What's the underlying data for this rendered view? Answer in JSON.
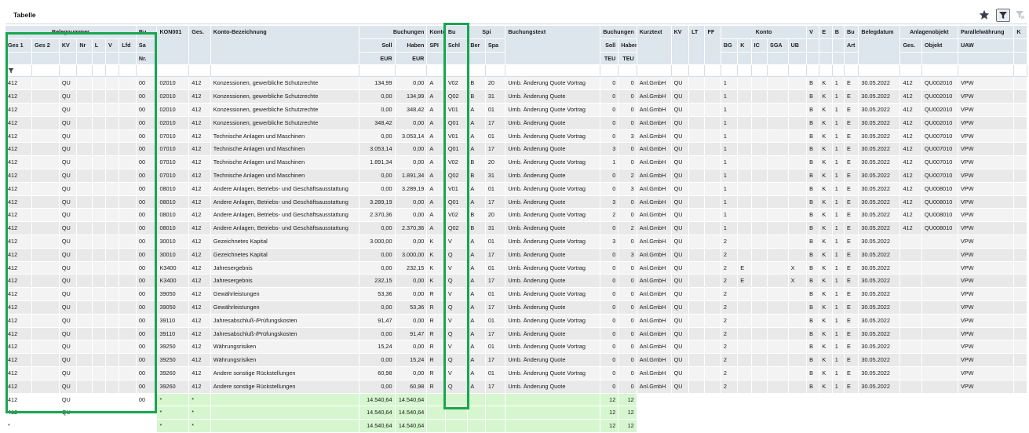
{
  "window": {
    "title": "Tabelle"
  },
  "toolbar": {
    "star_icon": "star-icon",
    "filter_icon": "filter-icon",
    "filter_off_icon": "filter-off-icon"
  },
  "colors": {
    "header_bg": "#dde5ed",
    "row_odd": "#e9e9e9",
    "row_even": "#f3f3f3",
    "sum_bg": "#d6f6cf",
    "highlight": "#18a650"
  },
  "header": {
    "belegnummer": "Belegnummer",
    "bu": "Bu",
    "sa": "Sa",
    "nr": "Nr.",
    "ges1": "Ges 1",
    "ges2": "Ges 2",
    "kv": "KV",
    "nr2": "Nr",
    "l": "L",
    "v": "V",
    "lfd": "Lfd",
    "kon": "KON001",
    "ges": "Ges.",
    "kontobez": "Konto-Bezeichnung",
    "buchungen": "Buchungen",
    "soll": "Soll",
    "haben": "Haben",
    "eur1": "EUR",
    "eur2": "EUR",
    "konto": "Konto",
    "spi": "SPI",
    "buschl_top": "Bu",
    "buschl_bot": "Schl",
    "spi_top": "Spi",
    "ber": "Ber",
    "spa": "Spa",
    "buchungstext": "Buchungstext",
    "buchungen2": "Buchungen",
    "soll2": "Soll",
    "haben2": "Haben",
    "teu1": "TEU",
    "teu2": "TEU",
    "kurztext": "Kurztext",
    "kv2": "KV",
    "lt": "LT",
    "ff": "FF",
    "konto2": "Konto",
    "bg": "BG",
    "k": "K",
    "ic": "IC",
    "sga": "SGA",
    "ub": "UB",
    "v2": "V",
    "e": "E",
    "b": "B",
    "buart_top": "Bu",
    "buart_bot": "Art",
    "belegdatum": "Belegdatum",
    "anlagenobjekt": "Anlagenobjekt",
    "ges3": "Ges.",
    "objekt": "Objekt",
    "parallel": "Parallelwährung",
    "uaw": "UAW",
    "k2": "K"
  },
  "rows": [
    [
      "412",
      "",
      "QU",
      "",
      "",
      "",
      "",
      "00",
      "02010",
      "412",
      "Konzessionen, gewerbliche Schutzrechte",
      "134,99",
      "0,00",
      "A",
      "V02",
      "B",
      "20",
      "Umb. Änderung Quote Vortrag",
      "0",
      "0",
      "Anl.GmbH",
      "QU",
      "",
      "",
      "1",
      "",
      "",
      "",
      "",
      "B",
      "K",
      "1",
      "E",
      "30.05.2022",
      "412",
      "QU002010",
      "VPW",
      ""
    ],
    [
      "412",
      "",
      "QU",
      "",
      "",
      "",
      "",
      "00",
      "02010",
      "412",
      "Konzessionen, gewerbliche Schutzrechte",
      "0,00",
      "134,99",
      "A",
      "Q02",
      "B",
      "31",
      "Umb. Änderung Quote",
      "0",
      "0",
      "Anl.GmbH",
      "QU",
      "",
      "",
      "1",
      "",
      "",
      "",
      "",
      "B",
      "K",
      "1",
      "E",
      "30.05.2022",
      "412",
      "QU002010",
      "VPW",
      ""
    ],
    [
      "412",
      "",
      "QU",
      "",
      "",
      "",
      "",
      "00",
      "02010",
      "412",
      "Konzessionen, gewerbliche Schutzrechte",
      "0,00",
      "348,42",
      "A",
      "V01",
      "A",
      "01",
      "Umb. Änderung Quote Vortrag",
      "0",
      "0",
      "Anl.GmbH",
      "QU",
      "",
      "",
      "1",
      "",
      "",
      "",
      "",
      "B",
      "K",
      "1",
      "E",
      "30.05.2022",
      "412",
      "QU002010",
      "VPW",
      ""
    ],
    [
      "412",
      "",
      "QU",
      "",
      "",
      "",
      "",
      "00",
      "02010",
      "412",
      "Konzessionen, gewerbliche Schutzrechte",
      "348,42",
      "0,00",
      "A",
      "Q01",
      "A",
      "17",
      "Umb. Änderung Quote",
      "0",
      "0",
      "Anl.GmbH",
      "QU",
      "",
      "",
      "1",
      "",
      "",
      "",
      "",
      "B",
      "K",
      "1",
      "E",
      "30.05.2022",
      "412",
      "QU002010",
      "VPW",
      ""
    ],
    [
      "412",
      "",
      "QU",
      "",
      "",
      "",
      "",
      "00",
      "07010",
      "412",
      "Technische Anlagen und Maschinen",
      "0,00",
      "3.053,14",
      "A",
      "V01",
      "A",
      "01",
      "Umb. Änderung Quote Vortrag",
      "0",
      "3",
      "Anl.GmbH",
      "QU",
      "",
      "",
      "1",
      "",
      "",
      "",
      "",
      "B",
      "K",
      "1",
      "E",
      "30.05.2022",
      "412",
      "QU007010",
      "VPW",
      ""
    ],
    [
      "412",
      "",
      "QU",
      "",
      "",
      "",
      "",
      "00",
      "07010",
      "412",
      "Technische Anlagen und Maschinen",
      "3.053,14",
      "0,00",
      "A",
      "Q01",
      "A",
      "17",
      "Umb. Änderung Quote",
      "3",
      "0",
      "Anl.GmbH",
      "QU",
      "",
      "",
      "1",
      "",
      "",
      "",
      "",
      "B",
      "K",
      "1",
      "E",
      "30.05.2022",
      "412",
      "QU007010",
      "VPW",
      ""
    ],
    [
      "412",
      "",
      "QU",
      "",
      "",
      "",
      "",
      "00",
      "07010",
      "412",
      "Technische Anlagen und Maschinen",
      "1.891,34",
      "0,00",
      "A",
      "V02",
      "B",
      "20",
      "Umb. Änderung Quote Vortrag",
      "1",
      "0",
      "Anl.GmbH",
      "QU",
      "",
      "",
      "1",
      "",
      "",
      "",
      "",
      "B",
      "K",
      "1",
      "E",
      "30.05.2022",
      "412",
      "QU007010",
      "VPW",
      ""
    ],
    [
      "412",
      "",
      "QU",
      "",
      "",
      "",
      "",
      "00",
      "07010",
      "412",
      "Technische Anlagen und Maschinen",
      "0,00",
      "1.891,34",
      "A",
      "Q02",
      "B",
      "31",
      "Umb. Änderung Quote",
      "0",
      "2",
      "Anl.GmbH",
      "QU",
      "",
      "",
      "1",
      "",
      "",
      "",
      "",
      "B",
      "K",
      "1",
      "E",
      "30.05.2022",
      "412",
      "QU007010",
      "VPW",
      ""
    ],
    [
      "412",
      "",
      "QU",
      "",
      "",
      "",
      "",
      "00",
      "08010",
      "412",
      "Andere Anlagen, Betriebs- und Geschäftsausstattung",
      "0,00",
      "3.289,19",
      "A",
      "V01",
      "A",
      "01",
      "Umb. Änderung Quote Vortrag",
      "0",
      "3",
      "Anl.GmbH",
      "QU",
      "",
      "",
      "1",
      "",
      "",
      "",
      "",
      "B",
      "K",
      "1",
      "E",
      "30.05.2022",
      "412",
      "QU008010",
      "VPW",
      ""
    ],
    [
      "412",
      "",
      "QU",
      "",
      "",
      "",
      "",
      "00",
      "08010",
      "412",
      "Andere Anlagen, Betriebs- und Geschäftsausstattung",
      "3.289,19",
      "0,00",
      "A",
      "Q01",
      "A",
      "17",
      "Umb. Änderung Quote",
      "3",
      "0",
      "Anl.GmbH",
      "QU",
      "",
      "",
      "1",
      "",
      "",
      "",
      "",
      "B",
      "K",
      "1",
      "E",
      "30.05.2022",
      "412",
      "QU008010",
      "VPW",
      ""
    ],
    [
      "412",
      "",
      "QU",
      "",
      "",
      "",
      "",
      "00",
      "08010",
      "412",
      "Andere Anlagen, Betriebs- und Geschäftsausstattung",
      "2.370,36",
      "0,00",
      "A",
      "V02",
      "B",
      "20",
      "Umb. Änderung Quote Vortrag",
      "2",
      "0",
      "Anl.GmbH",
      "QU",
      "",
      "",
      "1",
      "",
      "",
      "",
      "",
      "B",
      "K",
      "1",
      "E",
      "30.05.2022",
      "412",
      "QU008010",
      "VPW",
      ""
    ],
    [
      "412",
      "",
      "QU",
      "",
      "",
      "",
      "",
      "00",
      "08010",
      "412",
      "Andere Anlagen, Betriebs- und Geschäftsausstattung",
      "0,00",
      "2.370,36",
      "A",
      "Q02",
      "B",
      "31",
      "Umb. Änderung Quote",
      "0",
      "2",
      "Anl.GmbH",
      "QU",
      "",
      "",
      "1",
      "",
      "",
      "",
      "",
      "B",
      "K",
      "1",
      "E",
      "30.05.2022",
      "412",
      "QU008010",
      "VPW",
      ""
    ],
    [
      "412",
      "",
      "QU",
      "",
      "",
      "",
      "",
      "00",
      "30010",
      "412",
      "Gezeichnetes Kapital",
      "3.000,00",
      "0,00",
      "K",
      "V",
      "A",
      "01",
      "Umb. Änderung Quote Vortrag",
      "3",
      "0",
      "Anl.GmbH",
      "QU",
      "",
      "",
      "2",
      "",
      "",
      "",
      "",
      "B",
      "K",
      "1",
      "E",
      "30.05.2022",
      "",
      "",
      "VPW",
      ""
    ],
    [
      "412",
      "",
      "QU",
      "",
      "",
      "",
      "",
      "00",
      "30010",
      "412",
      "Gezeichnetes Kapital",
      "0,00",
      "3.000,00",
      "K",
      "Q",
      "A",
      "17",
      "Umb. Änderung Quote",
      "0",
      "3",
      "Anl.GmbH",
      "QU",
      "",
      "",
      "2",
      "",
      "",
      "",
      "",
      "B",
      "K",
      "1",
      "E",
      "30.05.2022",
      "",
      "",
      "VPW",
      ""
    ],
    [
      "412",
      "",
      "QU",
      "",
      "",
      "",
      "",
      "00",
      "K3400",
      "412",
      "Jahresergebnis",
      "0,00",
      "232,15",
      "K",
      "V",
      "A",
      "01",
      "Umb. Änderung Quote Vortrag",
      "0",
      "0",
      "Anl.GmbH",
      "QU",
      "",
      "",
      "2",
      "E",
      "",
      "",
      "X",
      "B",
      "K",
      "1",
      "E",
      "30.05.2022",
      "",
      "",
      "VPW",
      ""
    ],
    [
      "412",
      "",
      "QU",
      "",
      "",
      "",
      "",
      "00",
      "K3400",
      "412",
      "Jahresergebnis",
      "232,15",
      "0,00",
      "K",
      "Q",
      "A",
      "17",
      "Umb. Änderung Quote",
      "0",
      "0",
      "Anl.GmbH",
      "QU",
      "",
      "",
      "2",
      "E",
      "",
      "",
      "X",
      "B",
      "K",
      "1",
      "E",
      "30.05.2022",
      "",
      "",
      "VPW",
      ""
    ],
    [
      "412",
      "",
      "QU",
      "",
      "",
      "",
      "",
      "00",
      "39050",
      "412",
      "Gewährleistungen",
      "53,36",
      "0,00",
      "R",
      "V",
      "A",
      "01",
      "Umb. Änderung Quote Vortrag",
      "0",
      "0",
      "Anl.GmbH",
      "QU",
      "",
      "",
      "2",
      "",
      "",
      "",
      "",
      "B",
      "K",
      "1",
      "E",
      "30.05.2022",
      "",
      "",
      "VPW",
      ""
    ],
    [
      "412",
      "",
      "QU",
      "",
      "",
      "",
      "",
      "00",
      "39050",
      "412",
      "Gewährleistungen",
      "0,00",
      "53,36",
      "R",
      "Q",
      "A",
      "17",
      "Umb. Änderung Quote",
      "0",
      "0",
      "Anl.GmbH",
      "QU",
      "",
      "",
      "2",
      "",
      "",
      "",
      "",
      "B",
      "K",
      "1",
      "E",
      "30.05.2022",
      "",
      "",
      "VPW",
      ""
    ],
    [
      "412",
      "",
      "QU",
      "",
      "",
      "",
      "",
      "00",
      "39110",
      "412",
      "Jahresabschluß-/Prüfungskosten",
      "91,47",
      "0,00",
      "R",
      "V",
      "A",
      "01",
      "Umb. Änderung Quote Vortrag",
      "0",
      "0",
      "Anl.GmbH",
      "QU",
      "",
      "",
      "2",
      "",
      "",
      "",
      "",
      "B",
      "K",
      "1",
      "E",
      "30.05.2022",
      "",
      "",
      "VPW",
      ""
    ],
    [
      "412",
      "",
      "QU",
      "",
      "",
      "",
      "",
      "00",
      "39110",
      "412",
      "Jahresabschluß-/Prüfungskosten",
      "0,00",
      "91,47",
      "R",
      "Q",
      "A",
      "17",
      "Umb. Änderung Quote",
      "0",
      "0",
      "Anl.GmbH",
      "QU",
      "",
      "",
      "2",
      "",
      "",
      "",
      "",
      "B",
      "K",
      "1",
      "E",
      "30.05.2022",
      "",
      "",
      "VPW",
      ""
    ],
    [
      "412",
      "",
      "QU",
      "",
      "",
      "",
      "",
      "00",
      "39250",
      "412",
      "Währungsrisiken",
      "15,24",
      "0,00",
      "R",
      "V",
      "A",
      "01",
      "Umb. Änderung Quote Vortrag",
      "0",
      "0",
      "Anl.GmbH",
      "QU",
      "",
      "",
      "2",
      "",
      "",
      "",
      "",
      "B",
      "K",
      "1",
      "E",
      "30.05.2022",
      "",
      "",
      "VPW",
      ""
    ],
    [
      "412",
      "",
      "QU",
      "",
      "",
      "",
      "",
      "00",
      "39250",
      "412",
      "Währungsrisiken",
      "0,00",
      "15,24",
      "R",
      "Q",
      "A",
      "17",
      "Umb. Änderung Quote",
      "0",
      "0",
      "Anl.GmbH",
      "QU",
      "",
      "",
      "2",
      "",
      "",
      "",
      "",
      "B",
      "K",
      "1",
      "E",
      "30.05.2022",
      "",
      "",
      "VPW",
      ""
    ],
    [
      "412",
      "",
      "QU",
      "",
      "",
      "",
      "",
      "00",
      "39260",
      "412",
      "Andere sonstige Rückstellungen",
      "60,98",
      "0,00",
      "R",
      "V",
      "A",
      "01",
      "Umb. Änderung Quote Vortrag",
      "0",
      "0",
      "Anl.GmbH",
      "QU",
      "",
      "",
      "2",
      "",
      "",
      "",
      "",
      "B",
      "K",
      "1",
      "E",
      "30.05.2022",
      "",
      "",
      "VPW",
      ""
    ],
    [
      "412",
      "",
      "QU",
      "",
      "",
      "",
      "",
      "00",
      "39260",
      "412",
      "Andere sonstige Rückstellungen",
      "0,00",
      "60,98",
      "R",
      "Q",
      "A",
      "17",
      "Umb. Änderung Quote",
      "0",
      "0",
      "Anl.GmbH",
      "QU",
      "",
      "",
      "2",
      "",
      "",
      "",
      "",
      "B",
      "K",
      "1",
      "E",
      "30.05.2022",
      "",
      "",
      "VPW",
      ""
    ]
  ],
  "sum_rows": [
    [
      "412",
      "",
      "QU",
      "",
      "",
      "",
      "",
      "00",
      "*",
      "*",
      "",
      "14.540,64",
      "14.540,64",
      "",
      "",
      "",
      "",
      "",
      "12",
      "12"
    ],
    [
      "412",
      "",
      "QU",
      "",
      "",
      "",
      "",
      "",
      "*",
      "*",
      "",
      "14.540,64",
      "14.540,64",
      "",
      "",
      "",
      "",
      "",
      "12",
      "12"
    ],
    [
      "*",
      "",
      "",
      "",
      "",
      "",
      "",
      "",
      "*",
      "*",
      "",
      "14.540,64",
      "14.540,64",
      "",
      "",
      "",
      "",
      "",
      "12",
      "12"
    ]
  ]
}
